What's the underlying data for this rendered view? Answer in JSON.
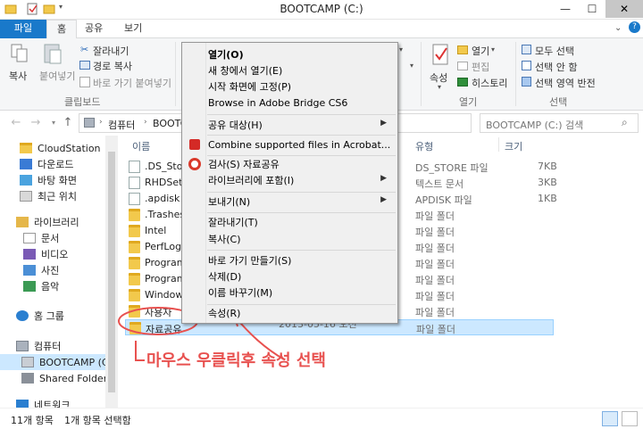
{
  "window": {
    "title": "BOOTCAMP (C:)"
  },
  "tabs": {
    "file": "파일",
    "home": "홈",
    "share": "공유",
    "view": "보기"
  },
  "ribbon": {
    "copy": "복사",
    "paste": "붙여넣기",
    "cut": "잘라내기",
    "copy_path": "경로 복사",
    "paste_shortcut": "바로 가기 붙여넣기",
    "clipboard_group": "클립보드",
    "properties": "속성",
    "open": "열기",
    "edit": "편집",
    "history": "히스토리",
    "open_group": "열기",
    "select_all": "모두 선택",
    "select_none": "선택 안 함",
    "invert_selection": "선택 영역 반전",
    "select_group": "선택"
  },
  "address": {
    "crumb1": "컴퓨터",
    "crumb2": "BOOTC",
    "search_placeholder": "BOOTCAMP (C:) 검색"
  },
  "nav": {
    "cloudstation": "CloudStation",
    "downloads": "다운로드",
    "desktop": "바탕 화면",
    "recent": "최근 위치",
    "libraries": "라이브러리",
    "documents": "문서",
    "videos": "비디오",
    "pictures": "사진",
    "music": "음악",
    "homegroup": "홈 그룹",
    "computer": "컴퓨터",
    "bootcamp": "BOOTCAMP (C:)",
    "shared_folders": "Shared Folders(\\",
    "network": "네트워크"
  },
  "columns": {
    "name": "이름",
    "type": "유형",
    "size": "크기"
  },
  "files": [
    {
      "name": ".DS_Stor",
      "type": "DS_STORE 파일",
      "size": "7KB",
      "kind": "doc"
    },
    {
      "name": "RHDSetu",
      "type": "텍스트 문서",
      "size": "3KB",
      "kind": "doc"
    },
    {
      "name": ".apdisk",
      "type": "APDISK 파일",
      "size": "1KB",
      "kind": "doc"
    },
    {
      "name": ".Trashes",
      "type": "파일 폴더",
      "size": "",
      "kind": "folder"
    },
    {
      "name": "Intel",
      "type": "파일 폴더",
      "size": "",
      "kind": "folder"
    },
    {
      "name": "PerfLogs",
      "type": "파일 폴더",
      "size": "",
      "kind": "folder"
    },
    {
      "name": "Program",
      "type": "파일 폴더",
      "size": "",
      "kind": "folder"
    },
    {
      "name": "Program",
      "type": "파일 폴더",
      "size": "",
      "kind": "folder"
    },
    {
      "name": "Window",
      "type": "파일 폴더",
      "size": "",
      "kind": "folder"
    },
    {
      "name": "사용자",
      "type": "파일 폴더",
      "size": "",
      "kind": "folder"
    },
    {
      "name": "자료공유",
      "type": "파일 폴더",
      "size": "",
      "kind": "folder"
    }
  ],
  "selected_date": "2013-05-16 오전",
  "status": {
    "count": "11개 항목",
    "selected": "1개 항목 선택함"
  },
  "menu": {
    "open": "열기(O)",
    "open_new_window": "새 창에서 열기(E)",
    "pin_start": "시작 화면에 고정(P)",
    "browse_bridge": "Browse in Adobe Bridge CS6",
    "share_with": "공유 대상(H)",
    "combine_acrobat": "Combine supported files in Acrobat...",
    "scan": "검사(S) 자료공유",
    "include_library": "라이브러리에 포함(I)",
    "send_to": "보내기(N)",
    "cut": "잘라내기(T)",
    "copy": "복사(C)",
    "create_shortcut": "바로 가기 만들기(S)",
    "delete": "삭제(D)",
    "rename": "이름 바꾸기(M)",
    "properties": "속성(R)"
  },
  "annotation": "마우스 우클릭후 속성 선택",
  "colors": {
    "accent": "#1979ca",
    "annotation": "#e8514f",
    "selection": "#cce8ff"
  }
}
